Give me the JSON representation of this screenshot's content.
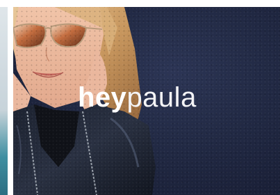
{
  "brand": {
    "part1": "hey",
    "part2": "paula"
  },
  "colors": {
    "background_wall": "#1b2139",
    "text": "#ffffff"
  },
  "image": {
    "subject": "hero-photo-woman-sunglasses"
  }
}
